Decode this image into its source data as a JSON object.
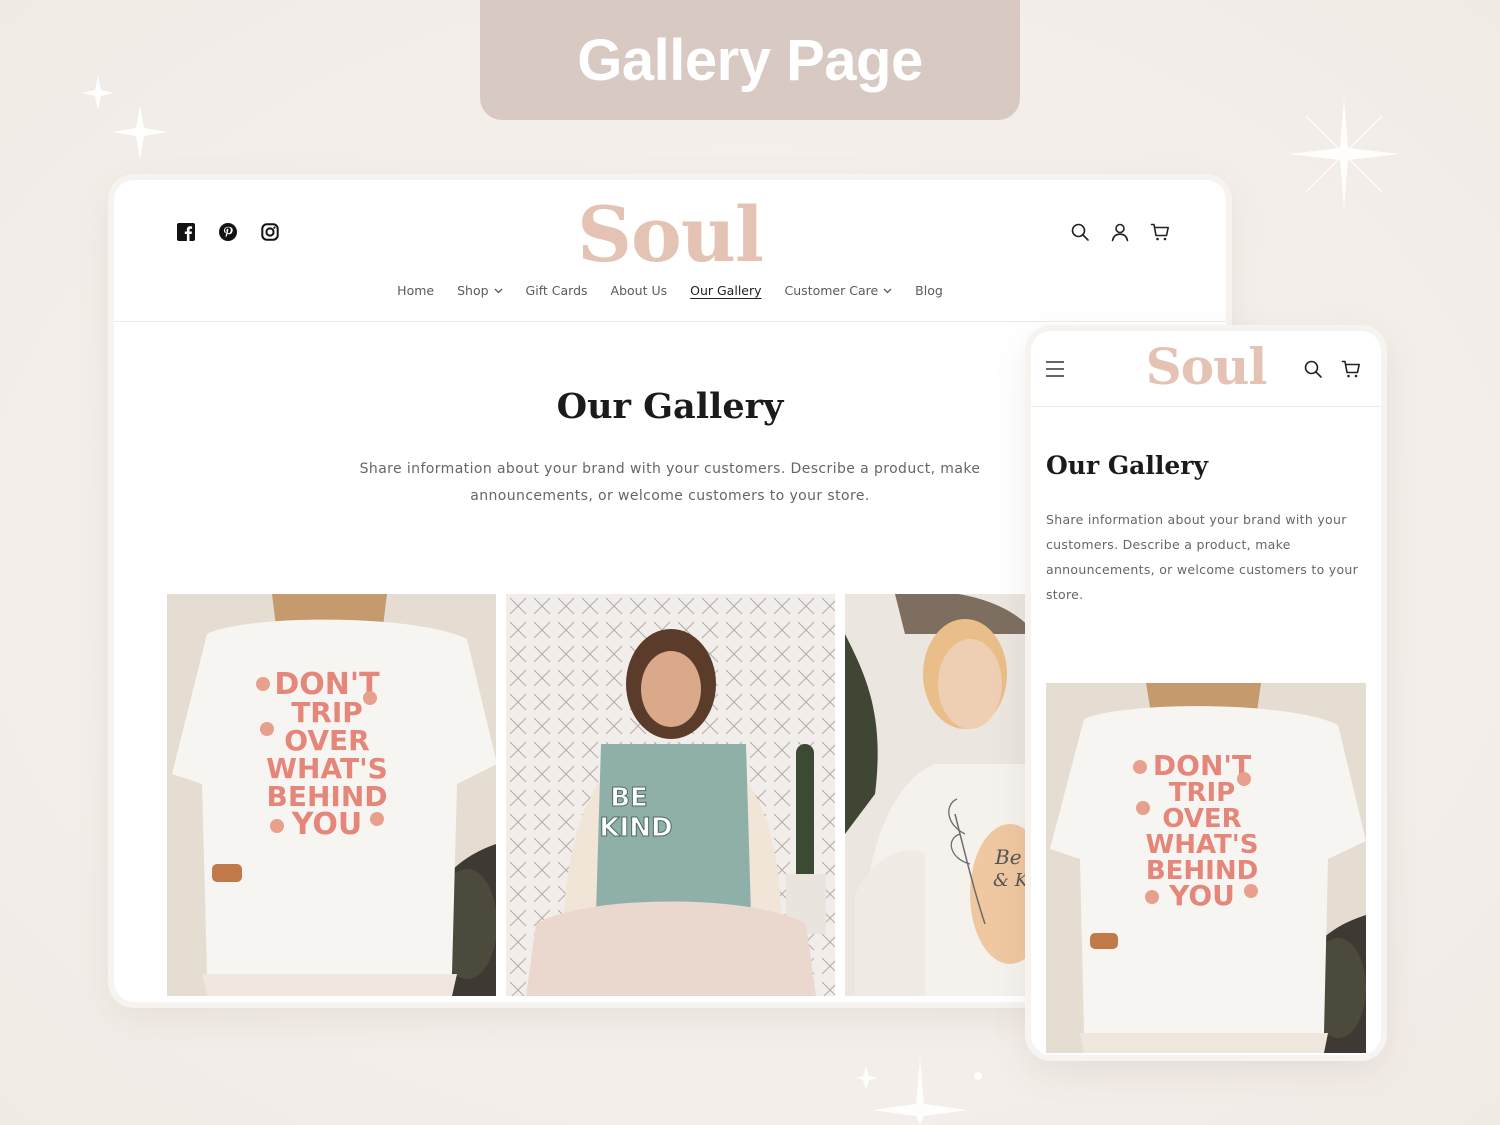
{
  "banner": {
    "title": "Gallery Page"
  },
  "desktop": {
    "logo": "Soul",
    "social_icons": [
      "facebook-icon",
      "pinterest-icon",
      "instagram-icon"
    ],
    "action_icons": [
      "search-icon",
      "account-icon",
      "cart-icon"
    ],
    "nav": [
      {
        "label": "Home",
        "dropdown": false,
        "active": false
      },
      {
        "label": "Shop",
        "dropdown": true,
        "active": false
      },
      {
        "label": "Gift Cards",
        "dropdown": false,
        "active": false
      },
      {
        "label": "About Us",
        "dropdown": false,
        "active": false
      },
      {
        "label": "Our Gallery",
        "dropdown": false,
        "active": true
      },
      {
        "label": "Customer Care",
        "dropdown": true,
        "active": false
      },
      {
        "label": "Blog",
        "dropdown": false,
        "active": false
      }
    ],
    "page_title": "Our Gallery",
    "description": "Share information about your brand with your customers. Describe a product, make announcements, or welcome customers to your store.",
    "gallery": [
      {
        "shirt_text": [
          "DON'T",
          "TRIP",
          "OVER",
          "WHAT'S",
          "BEHIND",
          "YOU"
        ]
      },
      {
        "shirt_text": [
          "BE",
          "KIND"
        ]
      },
      {
        "shirt_text": [
          "Be",
          "& KI"
        ]
      }
    ]
  },
  "mobile": {
    "logo": "Soul",
    "page_title": "Our Gallery",
    "description": "Share information about your brand with your customers. Describe a product, make announcements, or welcome customers to your store.",
    "photo": {
      "shirt_text": [
        "DON'T",
        "TRIP",
        "OVER",
        "WHAT'S",
        "BEHIND",
        "YOU"
      ]
    }
  },
  "colors": {
    "background": "#f4efeb",
    "banner": "#d8c9c3",
    "logo": "#e4c2b4",
    "shirt_pink": "#e5867a",
    "shirt_sage": "#8fb0a8"
  }
}
